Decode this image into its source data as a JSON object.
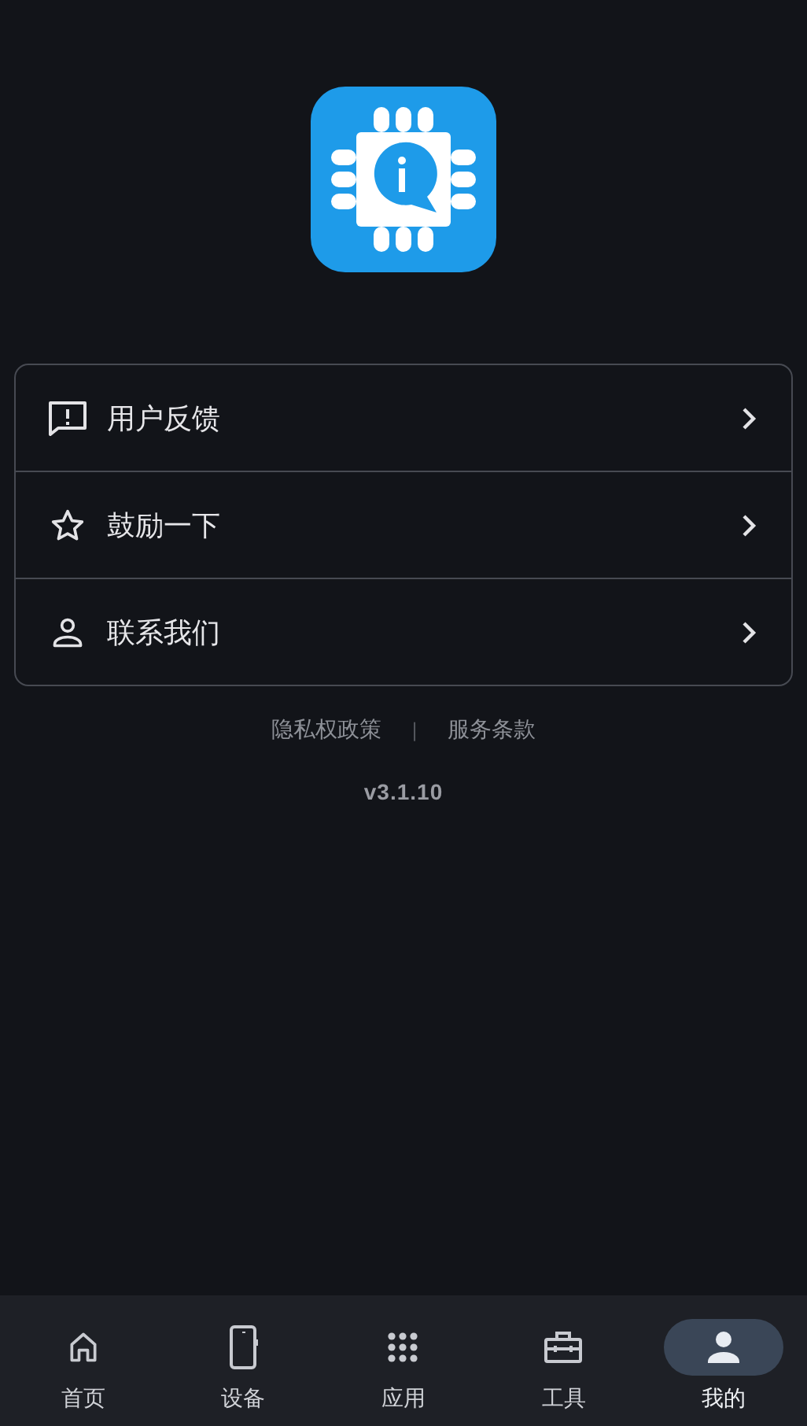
{
  "menu": [
    {
      "label": "用户反馈"
    },
    {
      "label": "鼓励一下"
    },
    {
      "label": "联系我们"
    }
  ],
  "links": [
    "隐私权政策",
    "服务条款"
  ],
  "separator": "|",
  "version": "v3.1.10",
  "nav": [
    {
      "label": "首页",
      "selected": false
    },
    {
      "label": "设备",
      "selected": false
    },
    {
      "label": "应用",
      "selected": false
    },
    {
      "label": "工具",
      "selected": false
    },
    {
      "label": "我的",
      "selected": true
    }
  ]
}
